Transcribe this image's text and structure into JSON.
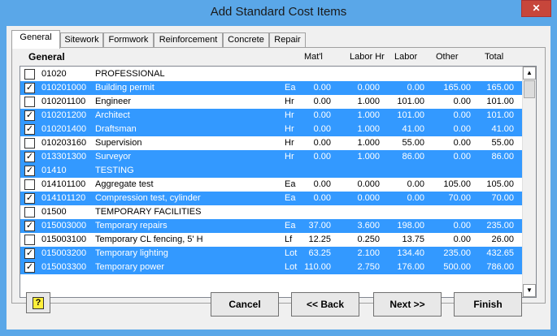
{
  "window": {
    "title": "Add Standard Cost Items",
    "close_glyph": "✕"
  },
  "tabs": [
    "General",
    "Sitework",
    "Formwork",
    "Reinforcement",
    "Concrete",
    "Repair"
  ],
  "active_tab": "General",
  "headers": {
    "group": "General",
    "matl": "Mat'l",
    "labor_hr": "Labor Hr",
    "labor": "Labor",
    "other": "Other",
    "total": "Total"
  },
  "rows": [
    {
      "code": "01020",
      "desc": "PROFESSIONAL",
      "unit": "",
      "matl": "",
      "labor_hr": "",
      "labor": "",
      "other": "",
      "total": "",
      "checked": false,
      "selected": false
    },
    {
      "code": "010201000",
      "desc": "Building permit",
      "unit": "Ea",
      "matl": "0.00",
      "labor_hr": "0.000",
      "labor": "0.00",
      "other": "165.00",
      "total": "165.00",
      "checked": true,
      "selected": true
    },
    {
      "code": "010201100",
      "desc": "Engineer",
      "unit": "Hr",
      "matl": "0.00",
      "labor_hr": "1.000",
      "labor": "101.00",
      "other": "0.00",
      "total": "101.00",
      "checked": false,
      "selected": false
    },
    {
      "code": "010201200",
      "desc": "Architect",
      "unit": "Hr",
      "matl": "0.00",
      "labor_hr": "1.000",
      "labor": "101.00",
      "other": "0.00",
      "total": "101.00",
      "checked": true,
      "selected": true
    },
    {
      "code": "010201400",
      "desc": "Draftsman",
      "unit": "Hr",
      "matl": "0.00",
      "labor_hr": "1.000",
      "labor": "41.00",
      "other": "0.00",
      "total": "41.00",
      "checked": true,
      "selected": true
    },
    {
      "code": "010203160",
      "desc": "Supervision",
      "unit": "Hr",
      "matl": "0.00",
      "labor_hr": "1.000",
      "labor": "55.00",
      "other": "0.00",
      "total": "55.00",
      "checked": false,
      "selected": false
    },
    {
      "code": "013301300",
      "desc": "Surveyor",
      "unit": "Hr",
      "matl": "0.00",
      "labor_hr": "1.000",
      "labor": "86.00",
      "other": "0.00",
      "total": "86.00",
      "checked": true,
      "selected": true
    },
    {
      "code": "01410",
      "desc": "TESTING",
      "unit": "",
      "matl": "",
      "labor_hr": "",
      "labor": "",
      "other": "",
      "total": "",
      "checked": true,
      "selected": true
    },
    {
      "code": "014101100",
      "desc": "Aggregate test",
      "unit": "Ea",
      "matl": "0.00",
      "labor_hr": "0.000",
      "labor": "0.00",
      "other": "105.00",
      "total": "105.00",
      "checked": false,
      "selected": false
    },
    {
      "code": "014101120",
      "desc": "Compression test, cylinder",
      "unit": "Ea",
      "matl": "0.00",
      "labor_hr": "0.000",
      "labor": "0.00",
      "other": "70.00",
      "total": "70.00",
      "checked": true,
      "selected": true
    },
    {
      "code": "01500",
      "desc": "TEMPORARY FACILITIES",
      "unit": "",
      "matl": "",
      "labor_hr": "",
      "labor": "",
      "other": "",
      "total": "",
      "checked": false,
      "selected": false
    },
    {
      "code": "015003000",
      "desc": "Temporary repairs",
      "unit": "Ea",
      "matl": "37.00",
      "labor_hr": "3.600",
      "labor": "198.00",
      "other": "0.00",
      "total": "235.00",
      "checked": true,
      "selected": true
    },
    {
      "code": "015003100",
      "desc": "Temporary CL fencing, 5' H",
      "unit": "Lf",
      "matl": "12.25",
      "labor_hr": "0.250",
      "labor": "13.75",
      "other": "0.00",
      "total": "26.00",
      "checked": false,
      "selected": false
    },
    {
      "code": "015003200",
      "desc": "Temporary lighting",
      "unit": "Lot",
      "matl": "63.25",
      "labor_hr": "2.100",
      "labor": "134.40",
      "other": "235.00",
      "total": "432.65",
      "checked": true,
      "selected": true
    },
    {
      "code": "015003300",
      "desc": "Temporary power",
      "unit": "Lot",
      "matl": "110.00",
      "labor_hr": "2.750",
      "labor": "176.00",
      "other": "500.00",
      "total": "786.00",
      "checked": true,
      "selected": true
    }
  ],
  "buttons": {
    "cancel": "Cancel",
    "back": "<< Back",
    "next": "Next >>",
    "finish": "Finish",
    "help_glyph": "?"
  },
  "scroll": {
    "up_glyph": "▲",
    "down_glyph": "▼"
  },
  "colors": {
    "titlebar": "#5aa7e8",
    "selection": "#3399ff",
    "close": "#c7463b"
  }
}
